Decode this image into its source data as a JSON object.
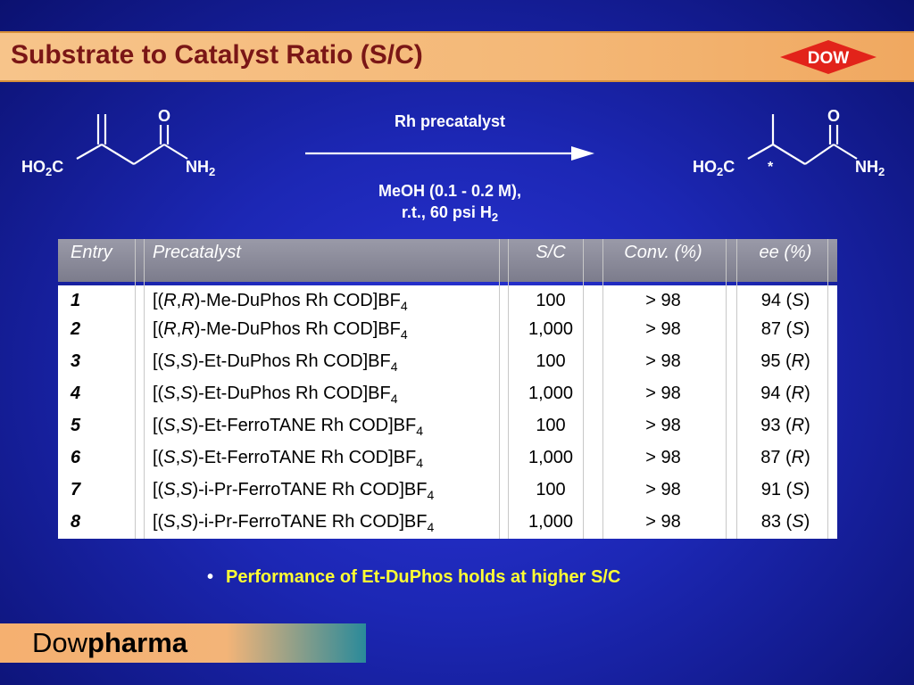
{
  "title": "Substrate to Catalyst Ratio (S/C)",
  "logo_text": "DOW",
  "scheme": {
    "reactant": {
      "left_group": "HO2C",
      "right_group": "NH2",
      "carbonyl": "O"
    },
    "product": {
      "left_group": "HO2C",
      "right_group": "NH2",
      "carbonyl": "O",
      "stereo_mark": "*"
    },
    "reagent_top": "Rh precatalyst",
    "conditions_line1": "MeOH (0.1 - 0.2 M),",
    "conditions_line2": "r.t., 60 psi H2"
  },
  "table": {
    "headers": [
      "Entry",
      "Precatalyst",
      "S/C",
      "Conv. (%)",
      "ee (%)"
    ],
    "rows": [
      {
        "entry": "1",
        "precatalyst": "[(R,R)-Me-DuPhos Rh COD]BF4",
        "sc": "100",
        "conv": "> 98",
        "ee": "94 (S)"
      },
      {
        "entry": "2",
        "precatalyst": "[(R,R)-Me-DuPhos Rh COD]BF4",
        "sc": "1,000",
        "conv": "> 98",
        "ee": "87 (S)"
      },
      {
        "entry": "3",
        "precatalyst": "[(S,S)-Et-DuPhos Rh COD]BF4",
        "sc": "100",
        "conv": "> 98",
        "ee": "95 (R)"
      },
      {
        "entry": "4",
        "precatalyst": "[(S,S)-Et-DuPhos Rh COD]BF4",
        "sc": "1,000",
        "conv": "> 98",
        "ee": "94 (R)"
      },
      {
        "entry": "5",
        "precatalyst": "[(S,S)-Et-FerroTANE Rh COD]BF4",
        "sc": "100",
        "conv": "> 98",
        "ee": "93 (R)"
      },
      {
        "entry": "6",
        "precatalyst": "[(S,S)-Et-FerroTANE Rh COD]BF4",
        "sc": "1,000",
        "conv": "> 98",
        "ee": "87 (R)"
      },
      {
        "entry": "7",
        "precatalyst": "[(S,S)-i-Pr-FerroTANE Rh COD]BF4",
        "sc": "100",
        "conv": "> 98",
        "ee": "91 (S)"
      },
      {
        "entry": "8",
        "precatalyst": "[(S,S)-i-Pr-FerroTANE Rh COD]BF4",
        "sc": "1,000",
        "conv": "> 98",
        "ee": "83 (S)"
      }
    ]
  },
  "bullet": "Performance of Et-DuPhos holds at higher S/C",
  "footer": {
    "brand_light": "Dow",
    "brand_bold": "pharma"
  },
  "colors": {
    "title": "#7a1616",
    "bullet": "#ffff33",
    "background": "#1c27b4"
  }
}
